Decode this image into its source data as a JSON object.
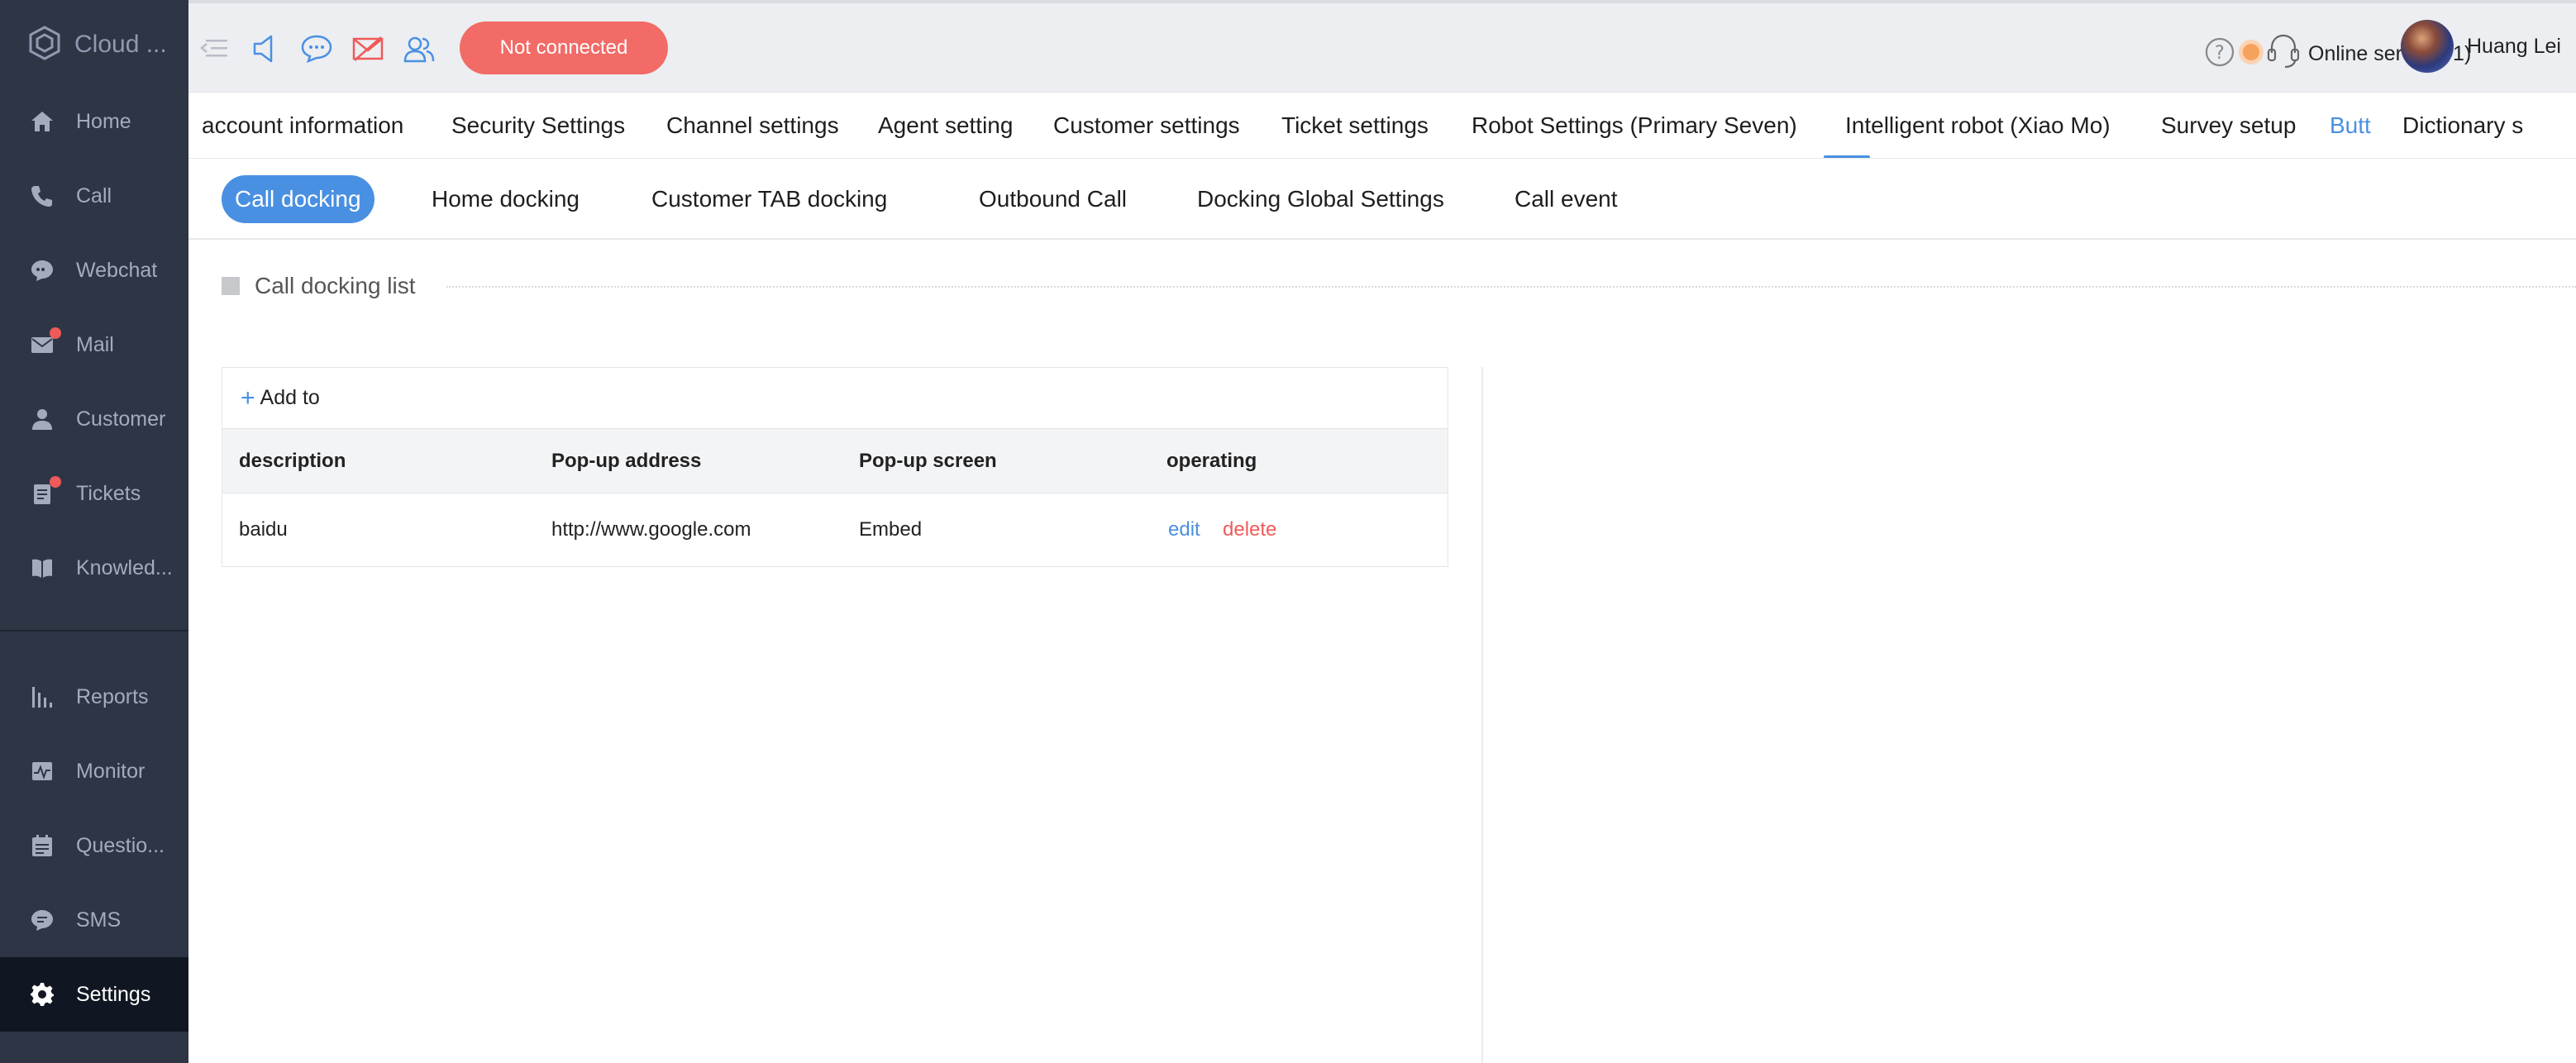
{
  "brand": {
    "name": "Cloud ..."
  },
  "sidebar": {
    "items": [
      {
        "label": "Home",
        "icon": "home-icon"
      },
      {
        "label": "Call",
        "icon": "phone-icon"
      },
      {
        "label": "Webchat",
        "icon": "chat-bubble-icon"
      },
      {
        "label": "Mail",
        "icon": "mail-icon",
        "badge": true
      },
      {
        "label": "Customer",
        "icon": "user-icon"
      },
      {
        "label": "Tickets",
        "icon": "clipboard-icon",
        "badge": true
      },
      {
        "label": "Knowled...",
        "icon": "book-icon"
      },
      {
        "label": "Reports",
        "icon": "bar-chart-icon"
      },
      {
        "label": "Monitor",
        "icon": "pulse-icon"
      },
      {
        "label": "Questio...",
        "icon": "calendar-icon"
      },
      {
        "label": "SMS",
        "icon": "sms-icon"
      },
      {
        "label": "Settings",
        "icon": "gear-icon",
        "active": true
      }
    ]
  },
  "topbar": {
    "status_label": "Not connected",
    "online_service": "Online service(-1)",
    "user_name": "Huang Lei"
  },
  "main_tabs": [
    "account information",
    "Security Settings",
    "Channel settings",
    "Agent setting",
    "Customer settings",
    "Ticket settings",
    "Robot Settings (Primary Seven)",
    "Intelligent robot (Xiao Mo)",
    "Survey setup",
    "Butt",
    "Dictionary s"
  ],
  "sub_tabs": [
    "Call docking",
    "Home docking",
    "Customer TAB docking",
    "Outbound Call",
    "Docking Global Settings",
    "Call event"
  ],
  "section": {
    "title": "Call docking list"
  },
  "table": {
    "add_label": "Add to",
    "columns": [
      "description",
      "Pop-up address",
      "Pop-up screen",
      "operating"
    ],
    "rows": [
      {
        "description": "baidu",
        "address": "http://www.google.com",
        "screen": "Embed",
        "edit": "edit",
        "delete": "delete"
      }
    ]
  },
  "colors": {
    "accent": "#4a90e2",
    "danger": "#f05a5a",
    "sidebar_bg": "#2e3645"
  }
}
